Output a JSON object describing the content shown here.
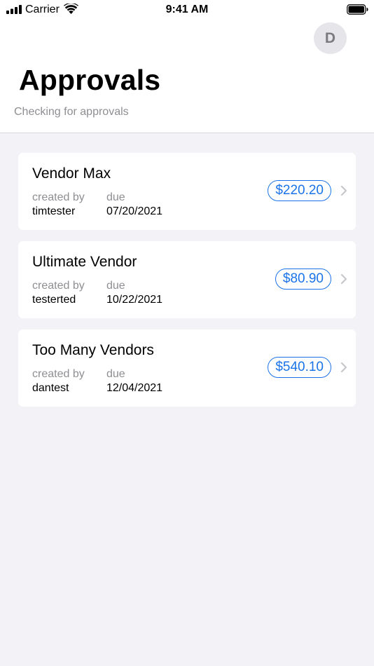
{
  "status_bar": {
    "carrier": "Carrier",
    "time": "9:41 AM",
    "signal_icon": "cellular-signal-icon",
    "wifi_icon": "wifi-icon",
    "battery_icon": "battery-icon"
  },
  "header": {
    "avatar_initial": "D",
    "title": "Approvals",
    "subtitle": "Checking for approvals"
  },
  "labels": {
    "created_by": "created by",
    "due": "due"
  },
  "approvals": [
    {
      "vendor": "Vendor Max",
      "created_by": "timtester",
      "due": "07/20/2021",
      "amount": "$220.20"
    },
    {
      "vendor": "Ultimate Vendor",
      "created_by": "testerted",
      "due": "10/22/2021",
      "amount": "$80.90"
    },
    {
      "vendor": "Too Many Vendors",
      "created_by": "dantest",
      "due": "12/04/2021",
      "amount": "$540.10"
    }
  ],
  "colors": {
    "accent": "#1a73e8",
    "background": "#f2f2f7",
    "secondary_text": "#8e8e93",
    "chevron": "#c7c7cc"
  }
}
